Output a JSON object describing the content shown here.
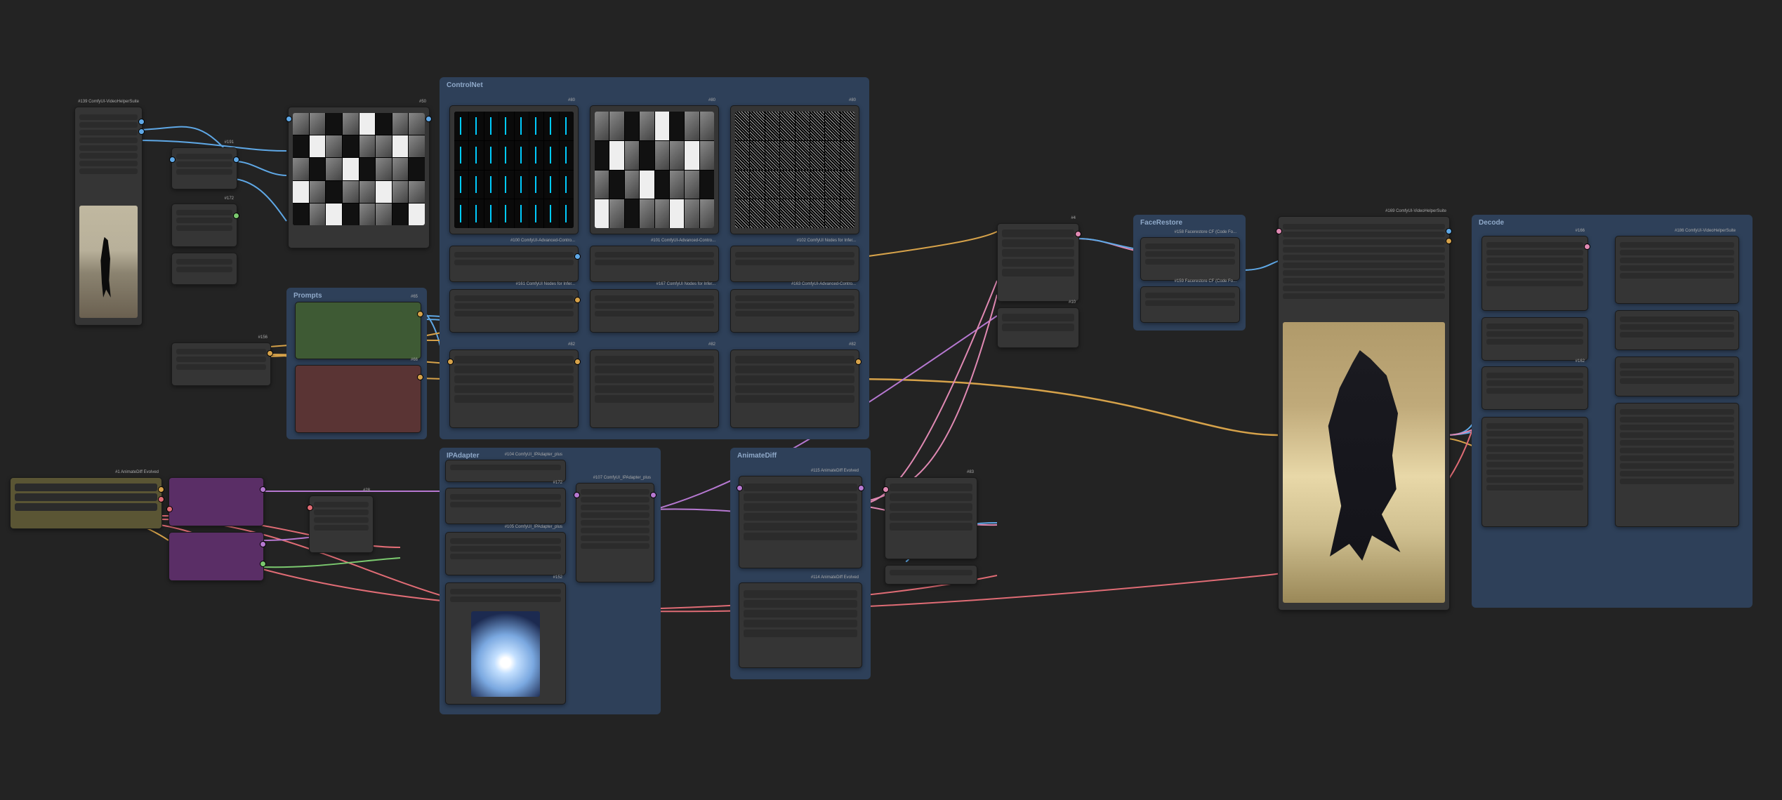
{
  "groups": {
    "controlnet": "ControlNet",
    "prompts": "Prompts",
    "ipadapter": "IPAdapter",
    "animatediff": "AnimateDiff",
    "facestore": "FaceRestore",
    "vae": "Decode"
  },
  "nodes": {
    "n_139": "#139 ComfyUI-VideoHelperSuite",
    "n_191": "#191",
    "n_172": "#172",
    "n_50": "#50",
    "n_156": "#156",
    "n_65": "#65",
    "n_66": "#66",
    "n_80a": "#80",
    "n_80b": "#80",
    "n_80c": "#80",
    "n_100": "#100 ComfyUI-Advanced-Contro...",
    "n_101": "#101 ComfyUI-Advanced-Contro...",
    "n_102": "#102 ComfyUI Nodes for Infer...",
    "n_161": "#161 ComfyUI Nodes for Infer...",
    "n_167": "#167 ComfyUI Nodes for Infer...",
    "n_163": "#163 ComfyUI-Advanced-Contro...",
    "n_82a": "#82",
    "n_82b": "#82",
    "n_82c": "#82",
    "n_103": "",
    "n_1": "#1 AnimateDiff Evolved",
    "n_155a": "",
    "n_155b": "",
    "n_28": "#28",
    "n_172b": "#172",
    "n_104": "#104 ComfyUI_IPAdapter_plus",
    "n_107": "#107 ComfyUI_IPAdapter_plus",
    "n_105": "#105 ComfyUI_IPAdapter_plus",
    "n_152": "#152",
    "n_thumb": "",
    "n_115": "#115 AnimateDiff Evolved",
    "n_114": "#114 AnimateDiff Evolved",
    "n_4": "#4",
    "n_10": "#10",
    "n_83": "#83",
    "n_158": "#158 Facerestore CF (Code Fo...",
    "n_159": "#159 Facerestore CF (Code Fo...",
    "n_169": "#169 ComfyUI-VideoHelperSuite",
    "n_166": "#166",
    "n_162": "#162",
    "n_186": "#186 ComfyUI-VideoHelperSuite",
    "n_186b": "",
    "n_186c": "",
    "n_186d": ""
  },
  "colors": {
    "red": "#e06c75",
    "green": "#7bc96f",
    "blue": "#5fa8e6",
    "orange": "#d6a24a",
    "purple": "#b678d1",
    "pink": "#e089b3",
    "teal": "#4fc3c3",
    "yellow": "#d9c95a"
  }
}
